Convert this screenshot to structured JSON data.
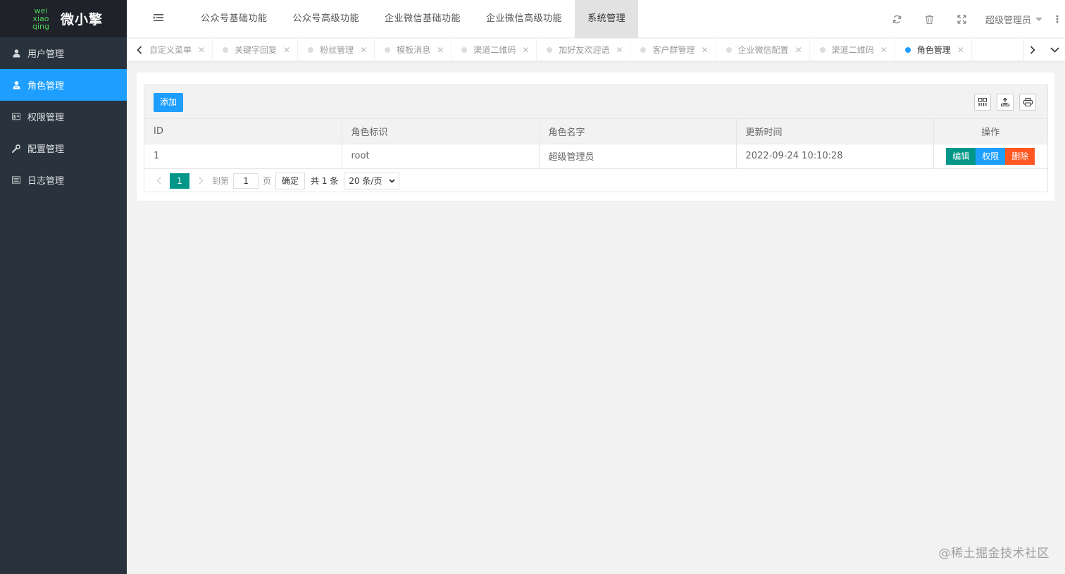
{
  "logo": {
    "mark_lines": [
      "wei",
      "xiao",
      "qing"
    ],
    "title": "微小擎",
    "accent": "#4dd35a"
  },
  "sidebar": {
    "items": [
      {
        "label": "用户管理",
        "icon": "user-icon"
      },
      {
        "label": "角色管理",
        "icon": "role-user-icon",
        "active": true
      },
      {
        "label": "权限管理",
        "icon": "id-card-icon"
      },
      {
        "label": "配置管理",
        "icon": "wrench-icon"
      },
      {
        "label": "日志管理",
        "icon": "list-icon"
      }
    ]
  },
  "header": {
    "nav": [
      "公众号基础功能",
      "公众号高级功能",
      "企业微信基础功能",
      "企业微信高级功能",
      "系统管理"
    ],
    "active_nav": "系统管理",
    "user": "超级管理员"
  },
  "tabs": [
    {
      "label": "自定义菜单"
    },
    {
      "label": "关键字回复"
    },
    {
      "label": "粉丝管理"
    },
    {
      "label": "模板消息"
    },
    {
      "label": "渠道二维码"
    },
    {
      "label": "加好友欢迎语"
    },
    {
      "label": "客户群管理"
    },
    {
      "label": "企业微信配置"
    },
    {
      "label": "渠道二维码"
    },
    {
      "label": "角色管理",
      "active": true
    }
  ],
  "toolbar": {
    "add_label": "添加"
  },
  "table": {
    "columns": [
      "ID",
      "角色标识",
      "角色名字",
      "更新时间",
      "操作"
    ],
    "rows": [
      {
        "id": "1",
        "key": "root",
        "name": "超级管理员",
        "updated": "2022-09-24 10:10:28"
      }
    ],
    "actions": {
      "edit": "编辑",
      "perm": "权限",
      "delete": "删除"
    }
  },
  "pager": {
    "current": "1",
    "goto_label": "到第",
    "goto_value": "1",
    "page_unit": "页",
    "confirm": "确定",
    "total": "共 1 条",
    "page_size": "20 条/页"
  },
  "colors": {
    "primary": "#1e9fff",
    "green": "#009688",
    "danger": "#ff5722",
    "sidebar_bg": "#28333e"
  },
  "watermark": "@稀土掘金技术社区"
}
